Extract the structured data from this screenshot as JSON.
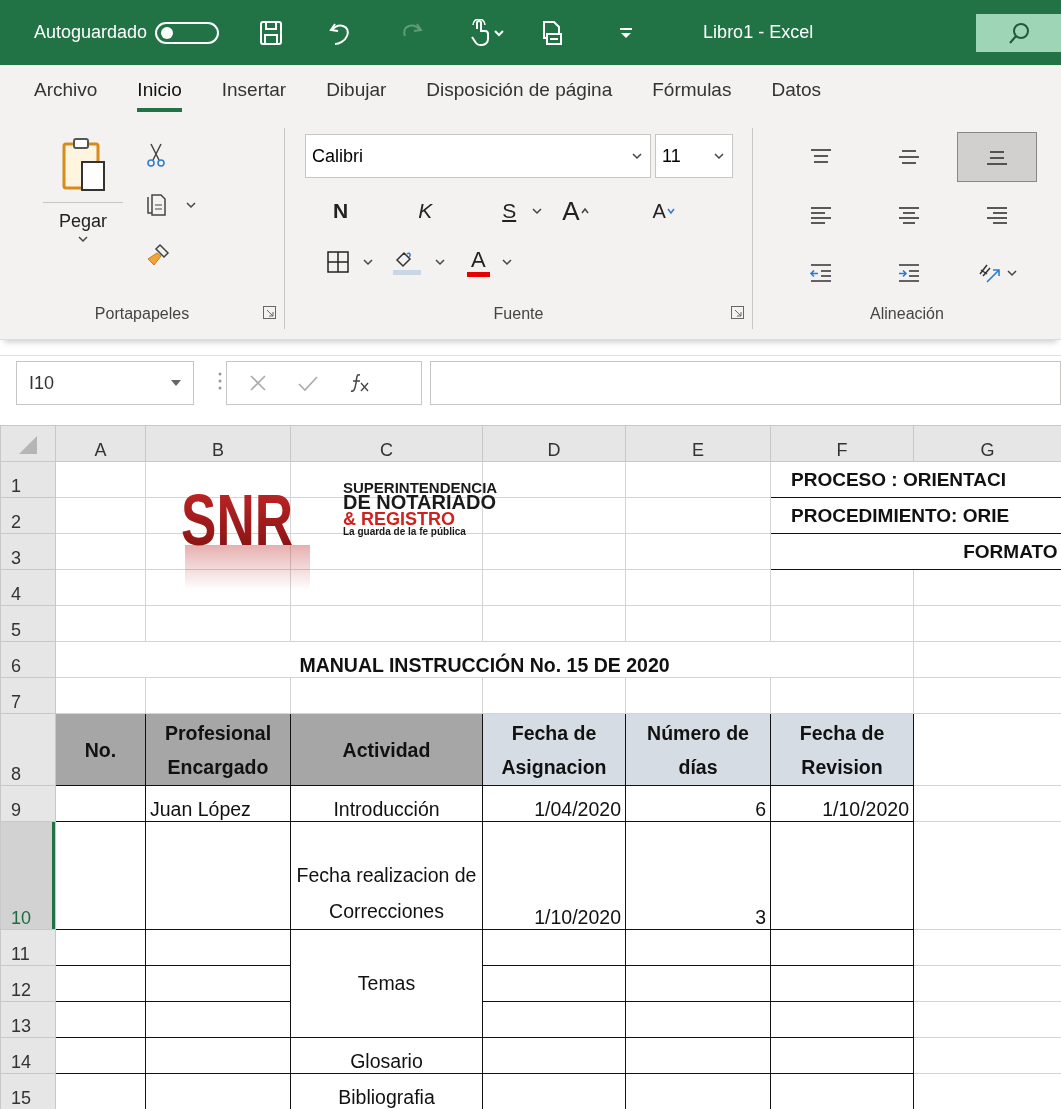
{
  "title_bar": {
    "autosave_label": "Autoguardado",
    "autosave_on": false,
    "title": "Libro1  -  Excel"
  },
  "tabs": [
    {
      "label": "Archivo",
      "selected": false
    },
    {
      "label": "Inicio",
      "selected": true
    },
    {
      "label": "Insertar",
      "selected": false
    },
    {
      "label": "Dibujar",
      "selected": false
    },
    {
      "label": "Disposición de página",
      "selected": false
    },
    {
      "label": "Fórmulas",
      "selected": false
    },
    {
      "label": "Datos",
      "selected": false
    }
  ],
  "ribbon": {
    "clipboard": {
      "paste_label": "Pegar",
      "group_label": "Portapapeles"
    },
    "font": {
      "font_name": "Calibri",
      "font_size": "11",
      "bold": "N",
      "italic": "K",
      "underline": "S",
      "grow": "A",
      "shrink": "A",
      "font_color": "A",
      "group_label": "Fuente"
    },
    "alignment": {
      "group_label": "Alineación",
      "vertical": [
        {
          "selected": false
        },
        {
          "selected": false
        },
        {
          "selected": true
        }
      ]
    }
  },
  "formula_bar": {
    "name_box": "I10"
  },
  "sheet": {
    "columns": [
      "A",
      "B",
      "C",
      "D",
      "E",
      "F",
      "G"
    ],
    "logo": {
      "letters": "SNR",
      "lines": [
        {
          "text": "SUPERINTENDENCIA",
          "color": "#1a1a1a"
        },
        {
          "text": "DE NOTARIADO",
          "color": "#1a1a1a"
        },
        {
          "text": "& REGISTRO",
          "color": "#d0211c"
        },
        {
          "text": "La guarda de la fe pública",
          "color": "#1a1a1a"
        }
      ]
    },
    "rows": [
      {
        "number": "1",
        "selected": false,
        "cells": {
          "F": {
            "text": "PROCESO : ORIENTACI",
            "kind": "box"
          }
        }
      },
      {
        "number": "2",
        "selected": false,
        "cells": {
          "F": {
            "text": "PROCEDIMIENTO: ORIE",
            "kind": "box"
          }
        }
      },
      {
        "number": "3",
        "selected": false,
        "cells": {
          "F": {
            "text": "FORMATO",
            "kind": "boxend"
          }
        }
      },
      {
        "number": "4",
        "selected": false,
        "cells": {}
      },
      {
        "number": "5",
        "selected": false,
        "cells": {}
      },
      {
        "number": "6",
        "selected": false,
        "cells": {
          "A": {
            "text": "MANUAL INSTRUCCIÓN No.  15 DE 2020",
            "kind": "title"
          }
        }
      },
      {
        "number": "7",
        "selected": false,
        "cells": {}
      },
      {
        "number": "8",
        "selected": false,
        "cells": {
          "A": {
            "text": "No.",
            "kind": "heading",
            "color": "#a6a6a6"
          },
          "B": {
            "text": "Profesional Encargado",
            "kind": "heading",
            "color": "#a6a6a6"
          },
          "C": {
            "text": "Actividad",
            "kind": "heading",
            "color": "#a6a6a6"
          },
          "D": {
            "text": "Fecha de Asignacion",
            "kind": "heading",
            "color": "#d6dce4"
          },
          "E": {
            "text": "Número de días",
            "kind": "heading",
            "color": "#d6dce4"
          },
          "F": {
            "text": "Fecha de Revision",
            "kind": "heading",
            "color": "#d6dce4"
          }
        }
      },
      {
        "number": "9",
        "selected": false,
        "cells": {
          "B": {
            "text": "Juan López",
            "kind": "label"
          },
          "C": {
            "text": "Introducción"
          },
          "D": {
            "text": "1/04/2020",
            "kind": "number"
          },
          "E": {
            "text": "6",
            "kind": "number"
          },
          "F": {
            "text": "1/10/2020",
            "kind": "number"
          }
        }
      },
      {
        "number": "10",
        "selected": true,
        "cells": {
          "C": {
            "text": "Fecha realizacion de Correcciones"
          },
          "D": {
            "text": "1/10/2020",
            "kind": "number"
          },
          "E": {
            "text": "3",
            "kind": "number"
          }
        }
      },
      {
        "number": "11",
        "selected": false,
        "cells": {
          "C": {
            "text": "Temas",
            "kind": "middle"
          }
        }
      },
      {
        "number": "12",
        "selected": false,
        "cells": {}
      },
      {
        "number": "13",
        "selected": false,
        "cells": {}
      },
      {
        "number": "14",
        "selected": false,
        "cells": {
          "C": {
            "text": "Glosario"
          }
        }
      },
      {
        "number": "15",
        "selected": false,
        "cells": {
          "C": {
            "text": "Bibliografia"
          }
        }
      }
    ]
  }
}
